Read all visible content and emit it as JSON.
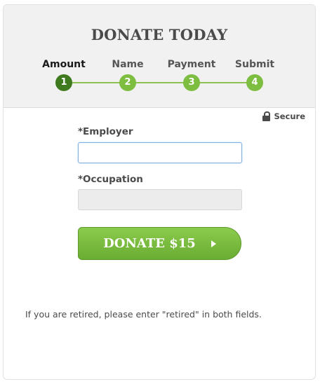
{
  "title": "DONATE TODAY",
  "steps": [
    {
      "label": "Amount",
      "number": "1"
    },
    {
      "label": "Name",
      "number": "2"
    },
    {
      "label": "Payment",
      "number": "3"
    },
    {
      "label": "Submit",
      "number": "4"
    }
  ],
  "active_step": "Amount",
  "secure_label": "Secure",
  "fields": {
    "employer": {
      "label": "*Employer",
      "value": "",
      "state": "focused"
    },
    "occupation": {
      "label": "*Occupation",
      "value": "",
      "state": "disabled"
    }
  },
  "donate_button_label": "DONATE $15",
  "note": "If you are retired, please enter \"retired\" in both fields.",
  "colors": {
    "accent_green": "#7dbd3f",
    "active_step": "#3f7a1e",
    "header_bg": "#f1f1f1"
  }
}
